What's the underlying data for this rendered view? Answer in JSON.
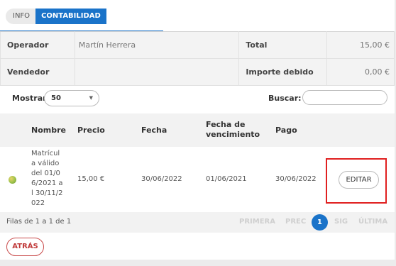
{
  "tabs": {
    "info": "INFO",
    "contabilidad": "CONTABILIDAD"
  },
  "summary": {
    "operador_label": "Operador",
    "operador_value": "Martín Herrera",
    "total_label": "Total",
    "total_value": "15,00 €",
    "vendedor_label": "Vendedor",
    "vendedor_value": "",
    "importe_label": "Importe debido",
    "importe_value": "0,00 €"
  },
  "controls": {
    "mostrar_label": "Mostrar",
    "mostrar_value": "50",
    "buscar_label": "Buscar:",
    "buscar_value": ""
  },
  "table": {
    "headers": {
      "nombre": "Nombre",
      "precio": "Precio",
      "fecha": "Fecha",
      "vencimiento": "Fecha de vencimiento",
      "pago": "Pago"
    },
    "rows": [
      {
        "nombre": "Matrícula válido del 01/06/2021 al 30/11/2022",
        "precio": "15,00 €",
        "fecha": "30/06/2022",
        "vencimiento": "01/06/2021",
        "pago": "30/06/2022",
        "action": "EDITAR"
      }
    ]
  },
  "footer": {
    "info": "Filas de 1 a 1 de 1",
    "primera": "PRIMERA",
    "prec": "PREC",
    "current": "1",
    "sig": "SIG",
    "ultima": "ÚLTIMA"
  },
  "back_button": "ATRÁS",
  "colors": {
    "accent": "#1a73c9",
    "highlight": "#e02020",
    "back": "#c03a3a"
  }
}
